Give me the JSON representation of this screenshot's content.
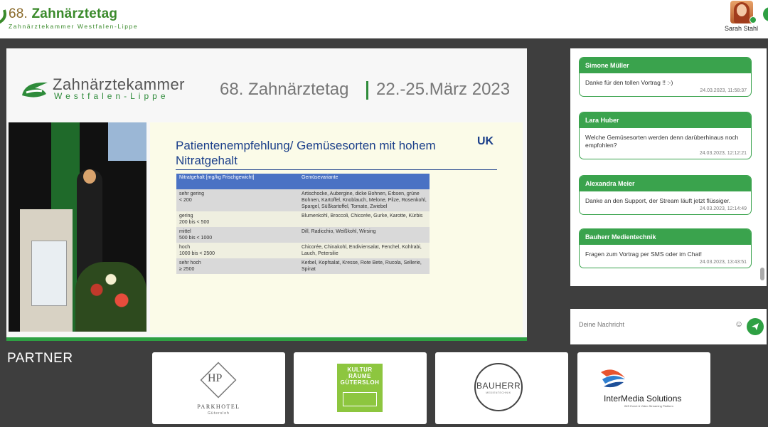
{
  "header": {
    "title_num": "68.",
    "title_text": "Zahnärztetag",
    "subtitle": "Zahnärztekammer Westfalen-Lippe",
    "user_name": "Sarah Stahl"
  },
  "video": {
    "org_name": "Zahnärztekammer",
    "org_sub": "Westfalen-Lippe",
    "event_title": "68. Zahnärztetag",
    "event_date": "22.-25.März 2023",
    "slide_title": "Patientenempfehlung/ Gemüsesorten mit hohem Nitratgehalt",
    "slide_logo": "UK",
    "table_headers": [
      "Nitratgehalt [mg/kg Frischgewicht]",
      "Gemüsevariante"
    ],
    "table_rows": [
      {
        "c1": "sehr gering\n< 200",
        "c2": "Artischocke, Aubergine, dicke Bohnen, Erbsen, grüne Bohnen, Kartoffel, Knoblauch, Melone, Pilze, Rosenkohl, Spargel, Süßkartoffel, Tomate, Zwiebel"
      },
      {
        "c1": "gering\n200 bis < 500",
        "c2": "Blumenkohl, Broccoli, Chicorée, Gurke, Karotte, Kürbis"
      },
      {
        "c1": "mittel\n500 bis < 1000",
        "c2": "Dill, Radicchio, Weißkohl, Wirsing"
      },
      {
        "c1": "hoch\n1000 bis < 2500",
        "c2": "Chicorée, Chinakohl, Endiviensalat, Fenchel, Kohlrabi, Lauch, Petersilie"
      },
      {
        "c1": "sehr hoch\n≥ 2500",
        "c2": "Kerbel, Kopfsalat, Kresse, Rote Bete, Rucola, Sellerie, Spinat"
      }
    ]
  },
  "chat": {
    "messages": [
      {
        "author": "Simone Müller",
        "text": "Danke für den tollen Vortrag !! :-)",
        "time": "24.03.2023, 11:58:37"
      },
      {
        "author": "Lara Huber",
        "text": "Welche Gemüsesorten werden denn darüberhinaus noch empfohlen?",
        "time": "24.03.2023, 12:12:21"
      },
      {
        "author": "Alexandra Meier",
        "text": "Danke an den Support, der Stream läuft jetzt flüssiger.",
        "time": "24.03.2023, 12:14:49"
      },
      {
        "author": "Bauherr Medientechnik",
        "text": "Fragen zum Vortrag per SMS oder im Chat!",
        "time": "24.03.2023, 13:43:51"
      }
    ],
    "input_placeholder": "Deine Nachricht"
  },
  "partners": {
    "heading": "PARTNER",
    "parkhotel_mono": "HP",
    "parkhotel_name": "PARKHOTEL",
    "parkhotel_city": "Gütersloh",
    "kultur_lines": [
      "KULTUR",
      "RÄUME",
      "GÜTERSLOH"
    ],
    "bauherr_name": "BAUHERR",
    "bauherr_tag": "MEDIENTECHNIK",
    "intermedia_name": "InterMedia Solutions",
    "intermedia_tag": "IMS Event & Video Streaming Platform"
  },
  "colors": {
    "accent": "#2ea043",
    "slide_blue": "#1b3f8a",
    "header_blue": "#4a72c4"
  }
}
